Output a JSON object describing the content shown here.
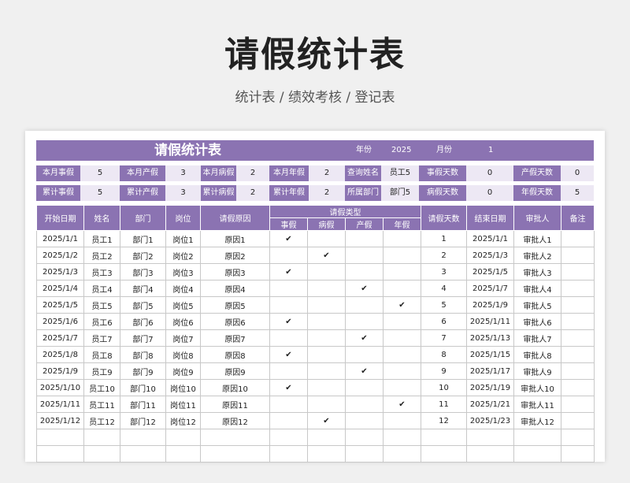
{
  "page": {
    "title": "请假统计表",
    "subtitle": "统计表 / 绩效考核 / 登记表"
  },
  "colors": {
    "accent": "#8b73b2",
    "value_bg": "#ede8f4",
    "background": "#f0f0f0"
  },
  "banner": {
    "title": "请假统计表",
    "year_label": "年份",
    "year_value": "2025",
    "month_label": "月份",
    "month_value": "1"
  },
  "summary_row1": [
    {
      "label": "本月事假",
      "value": "5"
    },
    {
      "label": "本月产假",
      "value": "3"
    },
    {
      "label": "本月病假",
      "value": "2"
    },
    {
      "label": "本月年假",
      "value": "2"
    },
    {
      "label": "查询姓名",
      "value": "员工5"
    },
    {
      "label": "事假天数",
      "value": "0"
    },
    {
      "label": "产假天数",
      "value": "0"
    }
  ],
  "summary_row2": [
    {
      "label": "累计事假",
      "value": "5"
    },
    {
      "label": "累计产假",
      "value": "3"
    },
    {
      "label": "累计病假",
      "value": "2"
    },
    {
      "label": "累计年假",
      "value": "2"
    },
    {
      "label": "所属部门",
      "value": "部门5"
    },
    {
      "label": "病假天数",
      "value": "0"
    },
    {
      "label": "年假天数",
      "value": "5"
    }
  ],
  "table": {
    "headers": {
      "start_date": "开始日期",
      "name": "姓名",
      "dept": "部门",
      "position": "岗位",
      "reason": "请假原因",
      "leave_type": "请假类型",
      "personal": "事假",
      "sick": "病假",
      "maternity": "产假",
      "annual": "年假",
      "days": "请假天数",
      "end_date": "结束日期",
      "approver": "审批人",
      "note": "备注"
    },
    "check_mark": "✔",
    "rows": [
      {
        "start": "2025/1/1",
        "name": "员工1",
        "dept": "部门1",
        "pos": "岗位1",
        "reason": "原因1",
        "type": "personal",
        "days": "1",
        "end": "2025/1/1",
        "approver": "审批人1",
        "note": ""
      },
      {
        "start": "2025/1/2",
        "name": "员工2",
        "dept": "部门2",
        "pos": "岗位2",
        "reason": "原因2",
        "type": "sick",
        "days": "2",
        "end": "2025/1/3",
        "approver": "审批人2",
        "note": ""
      },
      {
        "start": "2025/1/3",
        "name": "员工3",
        "dept": "部门3",
        "pos": "岗位3",
        "reason": "原因3",
        "type": "personal",
        "days": "3",
        "end": "2025/1/5",
        "approver": "审批人3",
        "note": ""
      },
      {
        "start": "2025/1/4",
        "name": "员工4",
        "dept": "部门4",
        "pos": "岗位4",
        "reason": "原因4",
        "type": "maternity",
        "days": "4",
        "end": "2025/1/7",
        "approver": "审批人4",
        "note": ""
      },
      {
        "start": "2025/1/5",
        "name": "员工5",
        "dept": "部门5",
        "pos": "岗位5",
        "reason": "原因5",
        "type": "annual",
        "days": "5",
        "end": "2025/1/9",
        "approver": "审批人5",
        "note": ""
      },
      {
        "start": "2025/1/6",
        "name": "员工6",
        "dept": "部门6",
        "pos": "岗位6",
        "reason": "原因6",
        "type": "personal",
        "days": "6",
        "end": "2025/1/11",
        "approver": "审批人6",
        "note": ""
      },
      {
        "start": "2025/1/7",
        "name": "员工7",
        "dept": "部门7",
        "pos": "岗位7",
        "reason": "原因7",
        "type": "maternity",
        "days": "7",
        "end": "2025/1/13",
        "approver": "审批人7",
        "note": ""
      },
      {
        "start": "2025/1/8",
        "name": "员工8",
        "dept": "部门8",
        "pos": "岗位8",
        "reason": "原因8",
        "type": "personal",
        "days": "8",
        "end": "2025/1/15",
        "approver": "审批人8",
        "note": ""
      },
      {
        "start": "2025/1/9",
        "name": "员工9",
        "dept": "部门9",
        "pos": "岗位9",
        "reason": "原因9",
        "type": "maternity",
        "days": "9",
        "end": "2025/1/17",
        "approver": "审批人9",
        "note": ""
      },
      {
        "start": "2025/1/10",
        "name": "员工10",
        "dept": "部门10",
        "pos": "岗位10",
        "reason": "原因10",
        "type": "personal",
        "days": "10",
        "end": "2025/1/19",
        "approver": "审批人10",
        "note": ""
      },
      {
        "start": "2025/1/11",
        "name": "员工11",
        "dept": "部门11",
        "pos": "岗位11",
        "reason": "原因11",
        "type": "annual",
        "days": "11",
        "end": "2025/1/21",
        "approver": "审批人11",
        "note": ""
      },
      {
        "start": "2025/1/12",
        "name": "员工12",
        "dept": "部门12",
        "pos": "岗位12",
        "reason": "原因12",
        "type": "sick",
        "days": "12",
        "end": "2025/1/23",
        "approver": "审批人12",
        "note": ""
      }
    ],
    "empty_rows": 2
  }
}
